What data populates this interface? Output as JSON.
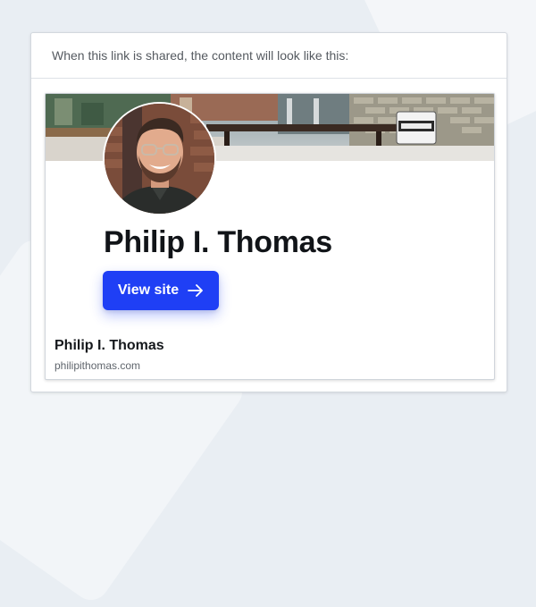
{
  "share_panel": {
    "header_text": "When this link is shared, the content will look like this:"
  },
  "preview": {
    "banner_image": "cafe-banner-image",
    "avatar_image": "profile-photo",
    "site_title": "Philip I. Thomas",
    "view_site_label": "View site",
    "view_site_icon": "arrow-right-icon",
    "link_title": "Philip I. Thomas",
    "link_domain": "philipithomas.com",
    "colors": {
      "button": "#1f3ff5",
      "title": "#111418",
      "domain": "#5f656c"
    }
  }
}
